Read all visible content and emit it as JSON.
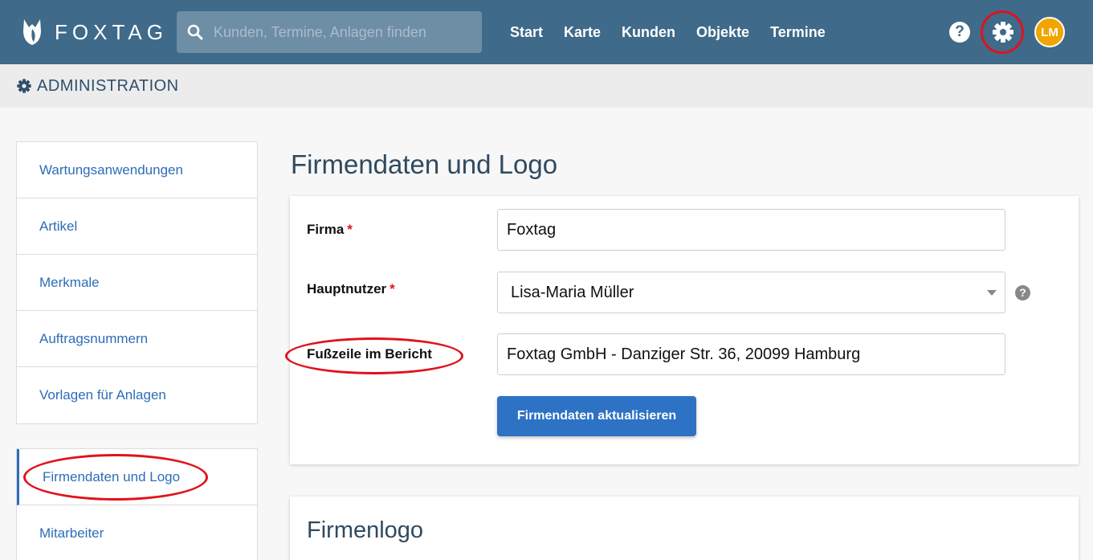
{
  "header": {
    "brand": "FOXTAG",
    "search_placeholder": "Kunden, Termine, Anlagen finden",
    "nav": [
      "Start",
      "Karte",
      "Kunden",
      "Objekte",
      "Termine"
    ],
    "help_label": "?",
    "avatar_initials": "LM",
    "colors": {
      "bar": "#3f6a8a",
      "avatar": "#f0a500",
      "highlight": "#e0121b"
    }
  },
  "subheader": {
    "title": "ADMINISTRATION"
  },
  "sidebar": {
    "group1": [
      "Wartungsanwendungen",
      "Artikel",
      "Merkmale",
      "Auftragsnummern",
      "Vorlagen für Anlagen"
    ],
    "group2": [
      "Firmendaten und Logo",
      "Mitarbeiter"
    ],
    "active": "Firmendaten und Logo"
  },
  "main": {
    "title": "Firmendaten und Logo",
    "form": {
      "firma_label": "Firma",
      "firma_value": "Foxtag",
      "hauptnutzer_label": "Hauptnutzer",
      "hauptnutzer_value": "Lisa-Maria Müller",
      "fusszeile_label": "Fußzeile im Bericht",
      "fusszeile_value": "Foxtag GmbH - Danziger Str. 36, 20099 Hamburg",
      "required_mark": "*",
      "help_label": "?",
      "submit_label": "Firmendaten aktualisieren"
    },
    "logo_section_title": "Firmenlogo"
  }
}
